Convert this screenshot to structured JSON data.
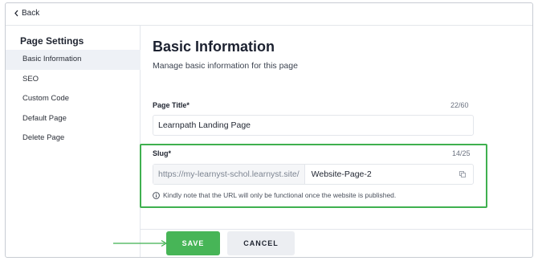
{
  "topbar": {
    "back_label": "Back"
  },
  "sidebar": {
    "title": "Page Settings",
    "items": [
      {
        "label": "Basic Information",
        "active": true
      },
      {
        "label": "SEO",
        "active": false
      },
      {
        "label": "Custom Code",
        "active": false
      },
      {
        "label": "Default Page",
        "active": false
      },
      {
        "label": "Delete Page",
        "active": false
      }
    ]
  },
  "main": {
    "title": "Basic Information",
    "subtitle": "Manage basic information for this page",
    "page_title_field": {
      "label": "Page Title*",
      "counter": "22/60",
      "value": "Learnpath Landing Page"
    },
    "slug_field": {
      "label": "Slug*",
      "counter": "14/25",
      "prefix": "https://my-learnyst-schol.learnyst.site/",
      "value": "Website-Page-2",
      "note": "Kindly note that the URL will only be functional once the website is published."
    }
  },
  "buttons": {
    "save": "SAVE",
    "cancel": "CANCEL"
  },
  "colors": {
    "accent_green": "#47b557",
    "highlight_border": "#3fb04f",
    "active_nav_bg": "#eef1f6"
  },
  "icons": [
    "chevron-left-icon",
    "copy-icon",
    "info-icon",
    "arrow-right-icon"
  ]
}
